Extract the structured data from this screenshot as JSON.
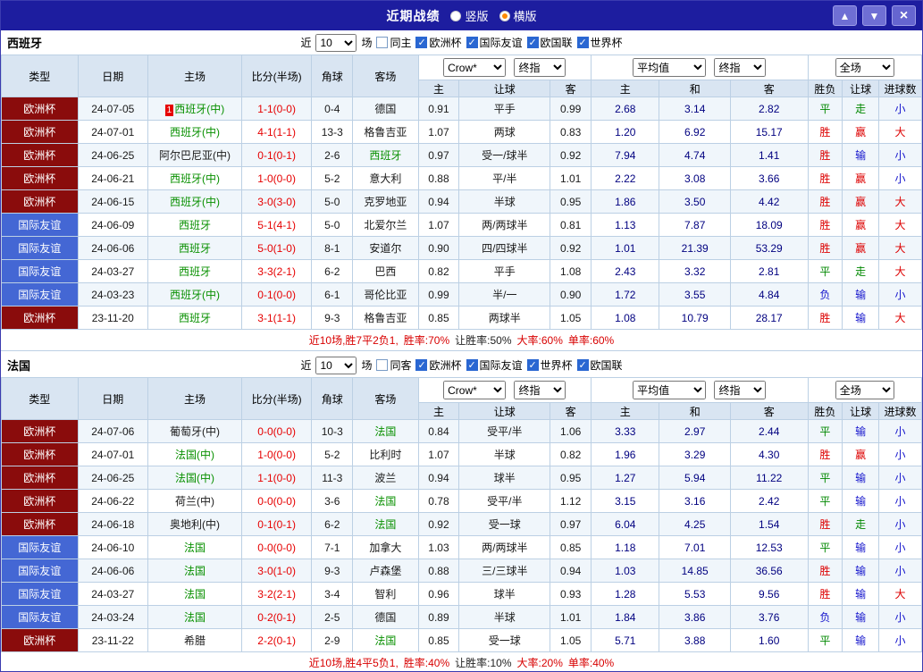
{
  "titlebar": {
    "title": "近期战绩",
    "radios": [
      {
        "label": "竖版",
        "selected": false
      },
      {
        "label": "横版",
        "selected": true
      }
    ],
    "buttons": {
      "up": "▲",
      "down": "▼",
      "close": "×"
    }
  },
  "colors": {
    "titlebar_bg": "#1d1d9f",
    "header_bg": "#d9e5f2",
    "alt_row_bg": "#f0f6fb",
    "focus_team": "#089000",
    "score": "#e60000"
  },
  "type_colors": {
    "欧洲杯": "#8a0c0c",
    "国际友谊": "#4467d4"
  },
  "result_colors": {
    "胜": "#dd0000",
    "平": "#008800",
    "负": "#1414cc",
    "赢": "#dd0000",
    "走": "#008800",
    "输": "#1414cc",
    "大": "#dd0000",
    "小": "#1414cc"
  },
  "table_header": {
    "static_cols": [
      "类型",
      "日期",
      "主场",
      "比分(半场)",
      "角球",
      "客场"
    ],
    "group1": {
      "select_a": "Crow*",
      "select_b": "终指",
      "subs": [
        "主",
        "让球",
        "客"
      ]
    },
    "group2": {
      "select_a": "平均值",
      "select_b": "终指",
      "subs": [
        "主",
        "和",
        "客"
      ]
    },
    "group3": {
      "select_a": "全场",
      "subs": [
        "胜负",
        "让球",
        "进球数"
      ]
    }
  },
  "sections": [
    {
      "team": "西班牙",
      "filter": {
        "near_label": "近",
        "count": "10",
        "games_label": "场",
        "same_label": "同主",
        "same_checked": false,
        "leagues": [
          "欧洲杯",
          "国际友谊",
          "欧国联",
          "世界杯"
        ]
      },
      "rows": [
        {
          "type": "欧洲杯",
          "date": "24-07-05",
          "home": "西班牙(中)",
          "home_focus": true,
          "home_badge": "1",
          "score": "1-1(0-0)",
          "corner": "0-4",
          "away": "德国",
          "away_focus": false,
          "odds": [
            "0.91",
            "平手",
            "0.99"
          ],
          "avg": [
            "2.68",
            "3.14",
            "2.82"
          ],
          "results": [
            "平",
            "走",
            "小"
          ]
        },
        {
          "type": "欧洲杯",
          "date": "24-07-01",
          "home": "西班牙(中)",
          "home_focus": true,
          "score": "4-1(1-1)",
          "corner": "13-3",
          "away": "格鲁吉亚",
          "away_focus": false,
          "odds": [
            "1.07",
            "两球",
            "0.83"
          ],
          "avg": [
            "1.20",
            "6.92",
            "15.17"
          ],
          "results": [
            "胜",
            "赢",
            "大"
          ]
        },
        {
          "type": "欧洲杯",
          "date": "24-06-25",
          "home": "阿尔巴尼亚(中)",
          "home_focus": false,
          "score": "0-1(0-1)",
          "corner": "2-6",
          "away": "西班牙",
          "away_focus": true,
          "odds": [
            "0.97",
            "受一/球半",
            "0.92"
          ],
          "avg": [
            "7.94",
            "4.74",
            "1.41"
          ],
          "results": [
            "胜",
            "输",
            "小"
          ]
        },
        {
          "type": "欧洲杯",
          "date": "24-06-21",
          "home": "西班牙(中)",
          "home_focus": true,
          "score": "1-0(0-0)",
          "corner": "5-2",
          "away": "意大利",
          "away_focus": false,
          "odds": [
            "0.88",
            "平/半",
            "1.01"
          ],
          "avg": [
            "2.22",
            "3.08",
            "3.66"
          ],
          "results": [
            "胜",
            "赢",
            "小"
          ]
        },
        {
          "type": "欧洲杯",
          "date": "24-06-15",
          "home": "西班牙(中)",
          "home_focus": true,
          "score": "3-0(3-0)",
          "corner": "5-0",
          "away": "克罗地亚",
          "away_focus": false,
          "odds": [
            "0.94",
            "半球",
            "0.95"
          ],
          "avg": [
            "1.86",
            "3.50",
            "4.42"
          ],
          "results": [
            "胜",
            "赢",
            "大"
          ]
        },
        {
          "type": "国际友谊",
          "date": "24-06-09",
          "home": "西班牙",
          "home_focus": true,
          "score": "5-1(4-1)",
          "corner": "5-0",
          "away": "北爱尔兰",
          "away_focus": false,
          "odds": [
            "1.07",
            "两/两球半",
            "0.81"
          ],
          "avg": [
            "1.13",
            "7.87",
            "18.09"
          ],
          "results": [
            "胜",
            "赢",
            "大"
          ]
        },
        {
          "type": "国际友谊",
          "date": "24-06-06",
          "home": "西班牙",
          "home_focus": true,
          "score": "5-0(1-0)",
          "corner": "8-1",
          "away": "安道尔",
          "away_focus": false,
          "odds": [
            "0.90",
            "四/四球半",
            "0.92"
          ],
          "avg": [
            "1.01",
            "21.39",
            "53.29"
          ],
          "results": [
            "胜",
            "赢",
            "大"
          ]
        },
        {
          "type": "国际友谊",
          "date": "24-03-27",
          "home": "西班牙",
          "home_focus": true,
          "score": "3-3(2-1)",
          "corner": "6-2",
          "away": "巴西",
          "away_focus": false,
          "odds": [
            "0.82",
            "平手",
            "1.08"
          ],
          "avg": [
            "2.43",
            "3.32",
            "2.81"
          ],
          "results": [
            "平",
            "走",
            "大"
          ]
        },
        {
          "type": "国际友谊",
          "date": "24-03-23",
          "home": "西班牙(中)",
          "home_focus": true,
          "score": "0-1(0-0)",
          "corner": "6-1",
          "away": "哥伦比亚",
          "away_focus": false,
          "odds": [
            "0.99",
            "半/一",
            "0.90"
          ],
          "avg": [
            "1.72",
            "3.55",
            "4.84"
          ],
          "results": [
            "负",
            "输",
            "小"
          ]
        },
        {
          "type": "欧洲杯",
          "date": "23-11-20",
          "home": "西班牙",
          "home_focus": true,
          "score": "3-1(1-1)",
          "corner": "9-3",
          "away": "格鲁吉亚",
          "away_focus": false,
          "odds": [
            "0.85",
            "两球半",
            "1.05"
          ],
          "avg": [
            "1.08",
            "10.79",
            "28.17"
          ],
          "results": [
            "胜",
            "输",
            "大"
          ]
        }
      ],
      "summary": {
        "record": "近10场,胜7平2负1,",
        "win_rate": "胜率:70%",
        "handicap_rate": "让胜率:50%",
        "big_rate": "大率:60%",
        "single_rate": "单率:60%"
      }
    },
    {
      "team": "法国",
      "filter": {
        "near_label": "近",
        "count": "10",
        "games_label": "场",
        "same_label": "同客",
        "same_checked": false,
        "leagues": [
          "欧洲杯",
          "国际友谊",
          "世界杯",
          "欧国联"
        ]
      },
      "rows": [
        {
          "type": "欧洲杯",
          "date": "24-07-06",
          "home": "葡萄牙(中)",
          "home_focus": false,
          "score": "0-0(0-0)",
          "corner": "10-3",
          "away": "法国",
          "away_focus": true,
          "odds": [
            "0.84",
            "受平/半",
            "1.06"
          ],
          "avg": [
            "3.33",
            "2.97",
            "2.44"
          ],
          "results": [
            "平",
            "输",
            "小"
          ]
        },
        {
          "type": "欧洲杯",
          "date": "24-07-01",
          "home": "法国(中)",
          "home_focus": true,
          "score": "1-0(0-0)",
          "corner": "5-2",
          "away": "比利时",
          "away_focus": false,
          "odds": [
            "1.07",
            "半球",
            "0.82"
          ],
          "avg": [
            "1.96",
            "3.29",
            "4.30"
          ],
          "results": [
            "胜",
            "赢",
            "小"
          ]
        },
        {
          "type": "欧洲杯",
          "date": "24-06-25",
          "home": "法国(中)",
          "home_focus": true,
          "score": "1-1(0-0)",
          "corner": "11-3",
          "away": "波兰",
          "away_focus": false,
          "odds": [
            "0.94",
            "球半",
            "0.95"
          ],
          "avg": [
            "1.27",
            "5.94",
            "11.22"
          ],
          "results": [
            "平",
            "输",
            "小"
          ]
        },
        {
          "type": "欧洲杯",
          "date": "24-06-22",
          "home": "荷兰(中)",
          "home_focus": false,
          "score": "0-0(0-0)",
          "corner": "3-6",
          "away": "法国",
          "away_focus": true,
          "odds": [
            "0.78",
            "受平/半",
            "1.12"
          ],
          "avg": [
            "3.15",
            "3.16",
            "2.42"
          ],
          "results": [
            "平",
            "输",
            "小"
          ]
        },
        {
          "type": "欧洲杯",
          "date": "24-06-18",
          "home": "奥地利(中)",
          "home_focus": false,
          "score": "0-1(0-1)",
          "corner": "6-2",
          "away": "法国",
          "away_focus": true,
          "odds": [
            "0.92",
            "受一球",
            "0.97"
          ],
          "avg": [
            "6.04",
            "4.25",
            "1.54"
          ],
          "results": [
            "胜",
            "走",
            "小"
          ]
        },
        {
          "type": "国际友谊",
          "date": "24-06-10",
          "home": "法国",
          "home_focus": true,
          "score": "0-0(0-0)",
          "corner": "7-1",
          "away": "加拿大",
          "away_focus": false,
          "odds": [
            "1.03",
            "两/两球半",
            "0.85"
          ],
          "avg": [
            "1.18",
            "7.01",
            "12.53"
          ],
          "results": [
            "平",
            "输",
            "小"
          ]
        },
        {
          "type": "国际友谊",
          "date": "24-06-06",
          "home": "法国",
          "home_focus": true,
          "score": "3-0(1-0)",
          "corner": "9-3",
          "away": "卢森堡",
          "away_focus": false,
          "odds": [
            "0.88",
            "三/三球半",
            "0.94"
          ],
          "avg": [
            "1.03",
            "14.85",
            "36.56"
          ],
          "results": [
            "胜",
            "输",
            "小"
          ]
        },
        {
          "type": "国际友谊",
          "date": "24-03-27",
          "home": "法国",
          "home_focus": true,
          "score": "3-2(2-1)",
          "corner": "3-4",
          "away": "智利",
          "away_focus": false,
          "odds": [
            "0.96",
            "球半",
            "0.93"
          ],
          "avg": [
            "1.28",
            "5.53",
            "9.56"
          ],
          "results": [
            "胜",
            "输",
            "大"
          ]
        },
        {
          "type": "国际友谊",
          "date": "24-03-24",
          "home": "法国",
          "home_focus": true,
          "score": "0-2(0-1)",
          "corner": "2-5",
          "away": "德国",
          "away_focus": false,
          "odds": [
            "0.89",
            "半球",
            "1.01"
          ],
          "avg": [
            "1.84",
            "3.86",
            "3.76"
          ],
          "results": [
            "负",
            "输",
            "小"
          ]
        },
        {
          "type": "欧洲杯",
          "date": "23-11-22",
          "home": "希腊",
          "home_focus": false,
          "score": "2-2(0-1)",
          "corner": "2-9",
          "away": "法国",
          "away_focus": true,
          "odds": [
            "0.85",
            "受一球",
            "1.05"
          ],
          "avg": [
            "5.71",
            "3.88",
            "1.60"
          ],
          "results": [
            "平",
            "输",
            "小"
          ]
        }
      ],
      "summary": {
        "record": "近10场,胜4平5负1,",
        "win_rate": "胜率:40%",
        "handicap_rate": "让胜率:10%",
        "big_rate": "大率:20%",
        "single_rate": "单率:40%"
      }
    }
  ]
}
